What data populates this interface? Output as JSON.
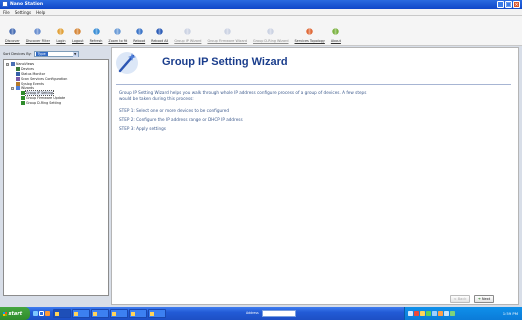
{
  "window": {
    "title": "Nano Station"
  },
  "menu": [
    "File",
    "Settings",
    "Help"
  ],
  "toolbar": [
    {
      "id": "discover",
      "label": "Discover",
      "icon": "search-icon",
      "disabled": false
    },
    {
      "id": "discover-filter",
      "label": "Discover Filter",
      "icon": "filter-icon",
      "disabled": false
    },
    {
      "id": "login",
      "label": "Login",
      "icon": "login-icon",
      "disabled": false
    },
    {
      "id": "logout",
      "label": "Logout",
      "icon": "logout-icon",
      "disabled": false
    },
    {
      "id": "refresh",
      "label": "Refresh",
      "icon": "refresh-icon",
      "disabled": false
    },
    {
      "id": "zoom-to-fit",
      "label": "Zoom to fit",
      "icon": "zoom-icon",
      "disabled": false
    },
    {
      "id": "reboot",
      "label": "Reboot",
      "icon": "reboot-icon",
      "disabled": false
    },
    {
      "id": "reboot-all",
      "label": "Reboot All",
      "icon": "reboot-all-icon",
      "disabled": false
    },
    {
      "id": "group-ip-wizard",
      "label": "Group IP Wizard",
      "icon": "ip-wizard-icon",
      "disabled": true
    },
    {
      "id": "group-firmware-wizard",
      "label": "Group Firmware Wizard",
      "icon": "firmware-wizard-icon",
      "disabled": true
    },
    {
      "id": "group-ring-wizard",
      "label": "Group D-Ring Wizard",
      "icon": "ring-wizard-icon",
      "disabled": true
    },
    {
      "id": "services-topology",
      "label": "Services Topology",
      "icon": "topology-icon",
      "disabled": false
    },
    {
      "id": "about",
      "label": "About",
      "icon": "about-icon",
      "disabled": false
    }
  ],
  "device_filter": {
    "label": "Sort Devices By:",
    "value": "Type"
  },
  "tree": [
    {
      "label": "NanoViews",
      "level": 0,
      "expander": "-",
      "icon": "computer-icon"
    },
    {
      "label": "Devices",
      "level": 1,
      "expander": "",
      "icon": "devices-icon"
    },
    {
      "label": "Status Monitor",
      "level": 1,
      "expander": "",
      "icon": "monitor-icon"
    },
    {
      "label": "Scan Services Configuration",
      "level": 1,
      "expander": "",
      "icon": "config-icon"
    },
    {
      "label": "Syslog Events",
      "level": 1,
      "expander": "",
      "icon": "log-icon"
    },
    {
      "label": "Wizards",
      "level": 1,
      "expander": "-",
      "icon": "wizard-icon"
    },
    {
      "label": "Group IP Setting",
      "level": 2,
      "expander": "",
      "icon": "arrow-icon",
      "selected": true
    },
    {
      "label": "Group Firmware Update",
      "level": 2,
      "expander": "",
      "icon": "arrow-icon"
    },
    {
      "label": "Group D-Ring Setting",
      "level": 2,
      "expander": "",
      "icon": "arrow-icon"
    }
  ],
  "wizard": {
    "title": "Group IP Setting Wizard",
    "description": "Group IP Setting Wizard helps you walk through whole IP address configure process of a group of devices. A few steps would be taken during this process:",
    "steps": [
      "STEP 1: Select one or more devices to be configured",
      "STEP 2: Configure the IP address range or DHCP IP address",
      "STEP 3: Apply settings"
    ],
    "buttons": {
      "back": "< Back",
      "next": "Next"
    }
  },
  "taskbar": {
    "start": "start",
    "tasks": [
      "",
      "",
      "",
      "",
      "",
      ""
    ],
    "address_label": "Address",
    "address_value": "",
    "clock": "1:59 PM"
  }
}
